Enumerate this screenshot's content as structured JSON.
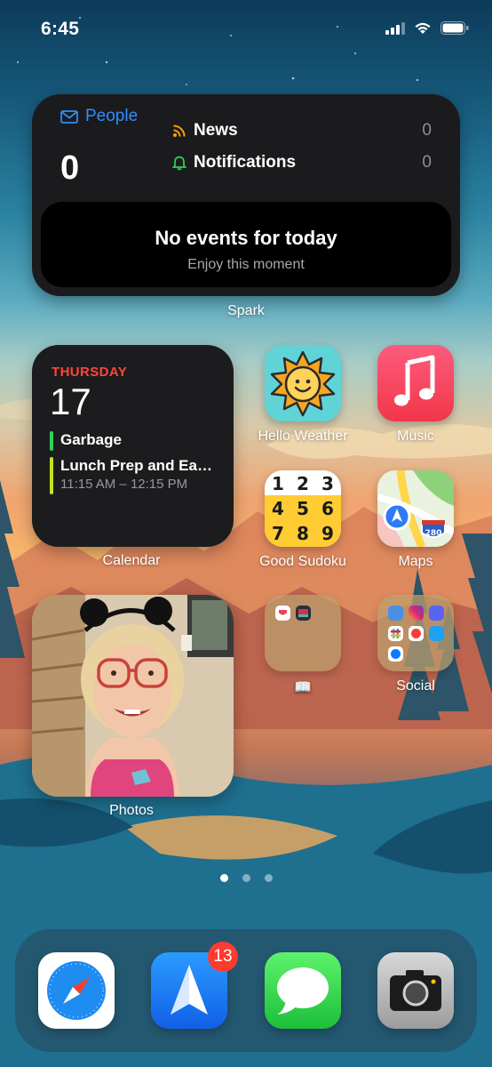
{
  "status_bar": {
    "time": "6:45"
  },
  "spark": {
    "people_label": "People",
    "people_count": "0",
    "rows": [
      {
        "label": "News",
        "count": "0"
      },
      {
        "label": "Notifications",
        "count": "0"
      }
    ],
    "events_title": "No events for today",
    "events_subtitle": "Enjoy this moment",
    "widget_label": "Spark"
  },
  "calendar": {
    "day": "THURSDAY",
    "date": "17",
    "events": [
      {
        "title": "Garbage",
        "time": ""
      },
      {
        "title": "Lunch Prep and Ea…",
        "time": "11:15 AM – 12:15 PM"
      }
    ],
    "widget_label": "Calendar"
  },
  "apps": {
    "hello_weather": "Hello Weather",
    "music": "Music",
    "good_sudoku": "Good Sudoku",
    "maps": "Maps",
    "reading_folder": "📖",
    "social_folder": "Social",
    "map_shield": "280"
  },
  "sudoku_digits": [
    "1",
    "2",
    "3",
    "4",
    "5",
    "6",
    "7",
    "8",
    "9"
  ],
  "photos": {
    "widget_label": "Photos"
  },
  "dock": {
    "spark_badge": "13"
  },
  "icons": [
    "mail-icon",
    "rss-icon",
    "bell-icon",
    "safari-icon",
    "spark-icon",
    "messages-icon",
    "camera-icon"
  ],
  "colors": {
    "accent_blue": "#2f8cff",
    "calendar_red": "#ff453a",
    "badge_red": "#ff3b30"
  }
}
